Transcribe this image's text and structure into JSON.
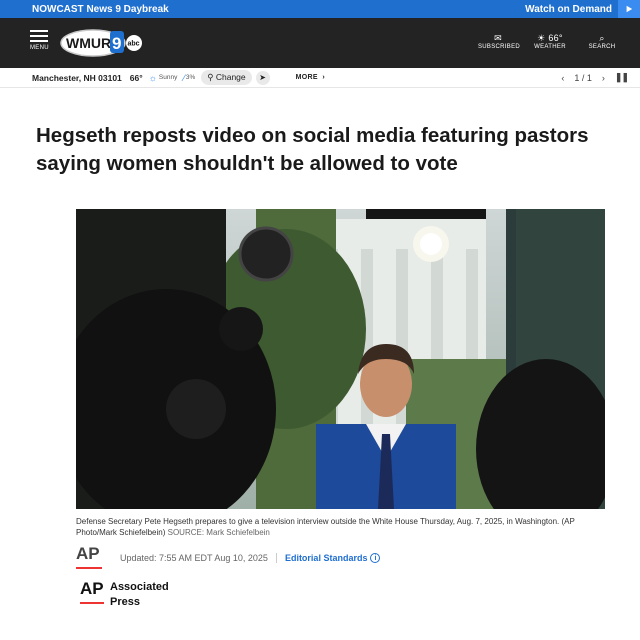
{
  "topbar": {
    "nowcast": "NOWCAST News 9 Daybreak",
    "watch": "Watch on Demand"
  },
  "header": {
    "menu_label": "MENU",
    "logo_text": "WMUR",
    "logo_channel": "9",
    "logo_network": "abc",
    "icons": [
      {
        "name": "subscribed",
        "glyph": "✉",
        "label": "SUBSCRIBED"
      },
      {
        "name": "weather",
        "glyph": "☀ 66°",
        "label": "WEATHER"
      },
      {
        "name": "search",
        "glyph": "⌕",
        "label": "SEARCH"
      }
    ]
  },
  "infobar": {
    "location": "Manchester, NH 03101",
    "temp": "66°",
    "condition": "Sunny",
    "precip": "3%",
    "change": "Change",
    "more": "MORE",
    "pager": "1 / 1"
  },
  "article": {
    "headline": "Hegseth reposts video on social media featuring pastors saying women shouldn't be allowed to vote",
    "caption": "Defense Secretary Pete Hegseth prepares to give a television interview outside the White House Thursday, Aug. 7, 2025, in Washington. (AP Photo/Mark Schiefelbein)",
    "source": "SOURCE: Mark Schiefelbein",
    "ap_mark": "AP",
    "updated": "Updated: 7:55 AM EDT Aug 10, 2025",
    "editorial_standards": "Editorial Standards",
    "byline_line1": "Associated",
    "byline_line2": "Press"
  },
  "colors": {
    "brand_blue": "#1f6fcf",
    "header_bg": "#232323",
    "ap_red": "#e33333"
  }
}
